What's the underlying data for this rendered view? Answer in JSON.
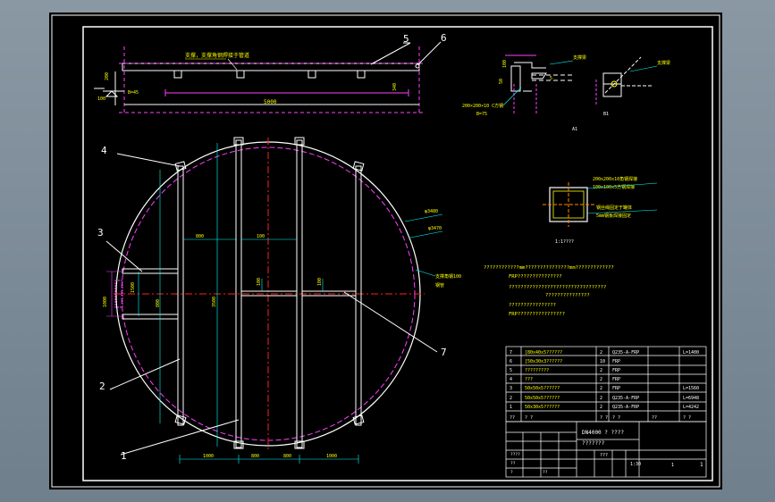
{
  "drawing": {
    "part_labels": [
      "1",
      "2",
      "3",
      "4",
      "5",
      "6",
      "7"
    ],
    "top_view": {
      "note": "支撑，支撑角钢焊接于管道",
      "dims": [
        "200",
        "100",
        "340",
        "5000"
      ],
      "note2": "B=45"
    },
    "detail_a": {
      "dims": [
        "100",
        "50",
        "5"
      ],
      "labels": [
        "支撑梁",
        "200×200×10 C方钢",
        "B=75"
      ],
      "caption": "A1"
    },
    "detail_b": {
      "labels": [
        "支撑梁"
      ],
      "caption": "B1"
    },
    "section": {
      "caption": "1:1????",
      "labels": [
        "200x200x10角钢焊接",
        "100x100x5方钢焊接",
        "钢丝绳固定于罐体",
        "5mm钢板焊接固定"
      ]
    },
    "main_view": {
      "labels": [
        "φ3480",
        "φ3470",
        "支撑角钢100",
        "钢管"
      ],
      "dims": [
        "800",
        "1000",
        "1500",
        "3500",
        "800",
        "100",
        "1000",
        "800",
        "800",
        "1000"
      ]
    },
    "notes": [
      "????????????mm???????????????mm?????????????",
      "FRP???????????????",
      "?????????????????????????????????",
      "???????????????",
      "????????????????",
      "FRP????????????????"
    ],
    "parts_table": {
      "rows": [
        [
          "7",
          "[80x40x5??????",
          "2",
          "Q235-A-FRP",
          "",
          "L=1400"
        ],
        [
          "6",
          "[50x30x3??????",
          "10",
          "FRP",
          "",
          ""
        ],
        [
          "5",
          "?????????",
          "2",
          "FRP",
          "",
          ""
        ],
        [
          "4",
          "???",
          "2",
          "FRP",
          "",
          ""
        ],
        [
          "3",
          "50x50x5??????",
          "2",
          "FRP",
          "",
          "L=1560"
        ],
        [
          "2",
          "50x50x5??????",
          "2",
          "Q235-A-FRP",
          "",
          "L=6948"
        ],
        [
          "1",
          "50x30x5??????",
          "2",
          "Q235-A-FRP",
          "",
          "L=4242"
        ]
      ],
      "header": [
        "??",
        "? ?",
        "? ?",
        "? ?",
        "??",
        "? ?"
      ]
    },
    "title_block": {
      "title": "DN4000 ? ????",
      "subtitle": "???????",
      "scale": "1:30",
      "sheet": "1",
      "sheets": "1",
      "items": [
        "????",
        "???",
        "??",
        "?",
        "??"
      ]
    }
  }
}
